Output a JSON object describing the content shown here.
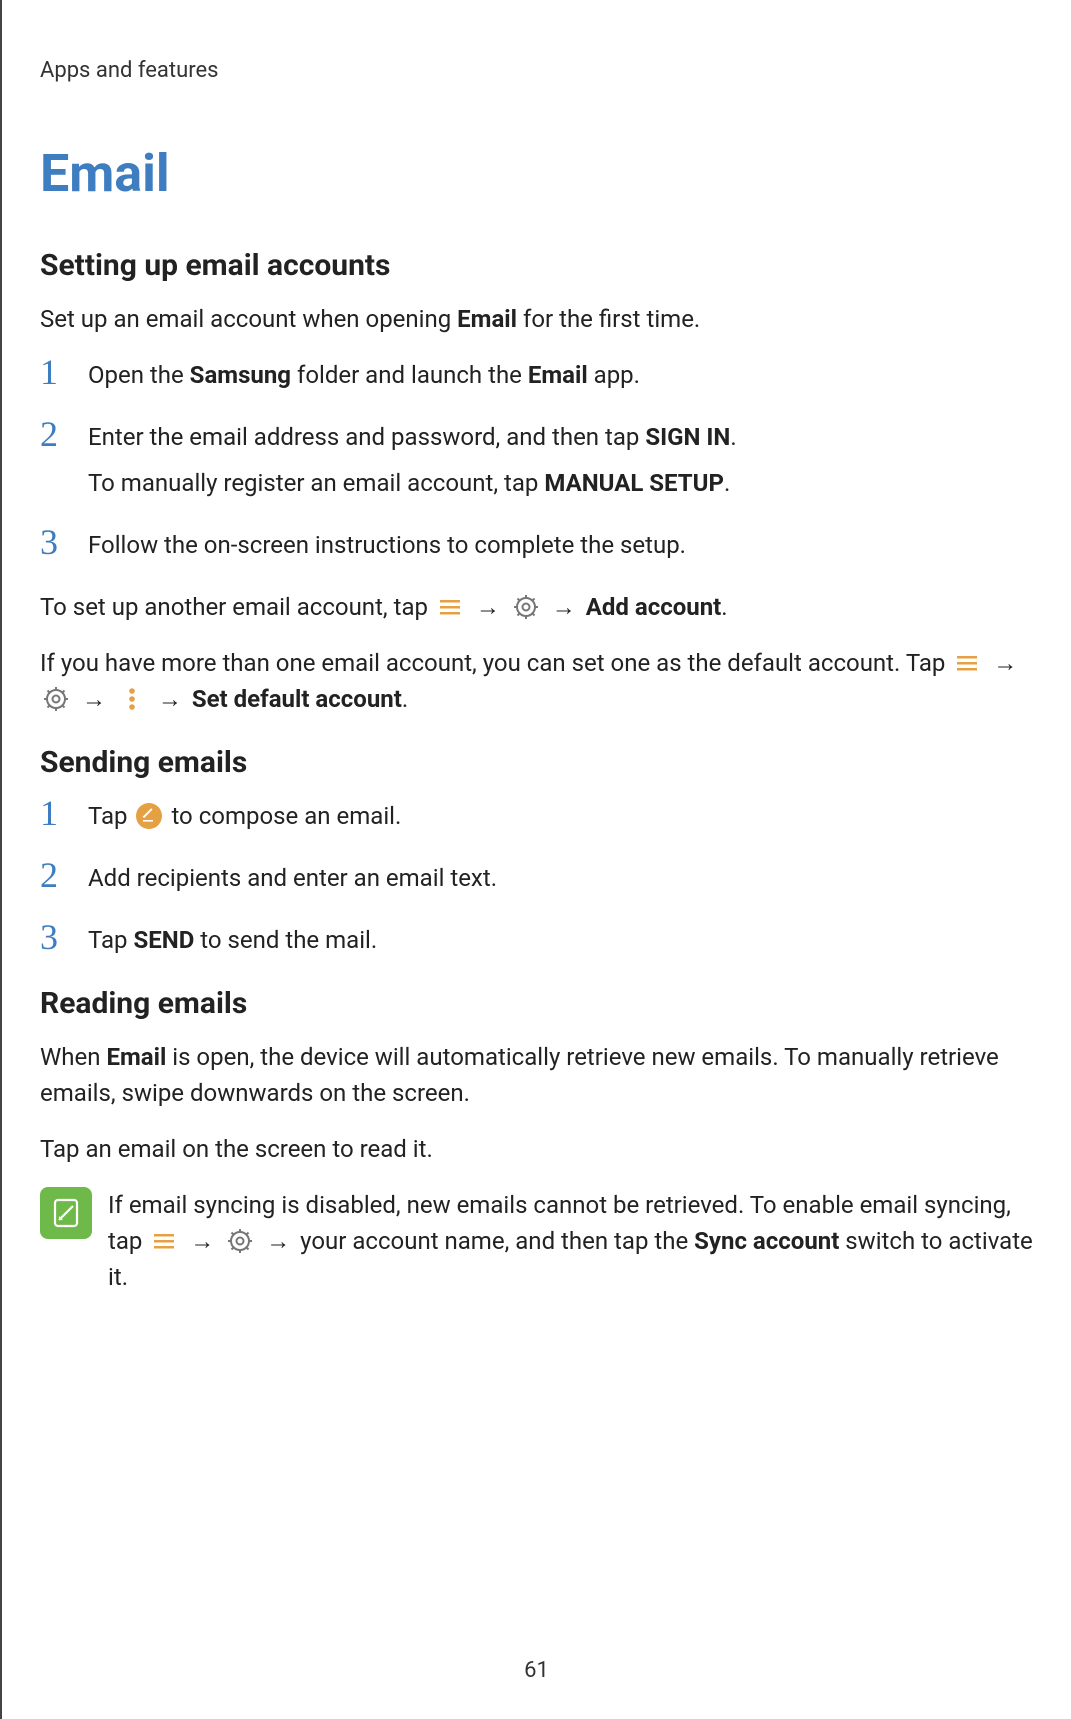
{
  "header": "Apps and features",
  "title": "Email",
  "page_number": "61",
  "section_setup": {
    "heading": "Setting up email accounts",
    "intro_pre": "Set up an email account when opening ",
    "intro_bold": "Email",
    "intro_post": " for the first time.",
    "steps": {
      "s1_pre": "Open the ",
      "s1_b1": "Samsung",
      "s1_mid": " folder and launch the ",
      "s1_b2": "Email",
      "s1_post": " app.",
      "s2_pre": "Enter the email address and password, and then tap ",
      "s2_b": "SIGN IN",
      "s2_post": ".",
      "s2_sub_pre": "To manually register an email account, tap ",
      "s2_sub_b": "MANUAL SETUP",
      "s2_sub_post": ".",
      "s3": "Follow the on-screen instructions to complete the setup."
    },
    "another_pre": "To set up another email account, tap ",
    "another_b": "Add account",
    "another_post": ".",
    "default_pre": "If you have more than one email account, you can set one as the default account. Tap ",
    "default_b": "Set default account",
    "default_post": "."
  },
  "section_send": {
    "heading": "Sending emails",
    "s1_pre": "Tap ",
    "s1_post": " to compose an email.",
    "s2": "Add recipients and enter an email text.",
    "s3_pre": "Tap ",
    "s3_b": "SEND",
    "s3_post": " to send the mail."
  },
  "section_read": {
    "heading": "Reading emails",
    "p1_pre": "When ",
    "p1_b": "Email",
    "p1_post": " is open, the device will automatically retrieve new emails. To manually retrieve emails, swipe downwards on the screen.",
    "p2": "Tap an email on the screen to read it.",
    "note_pre": "If email syncing is disabled, new emails cannot be retrieved. To enable email syncing, tap ",
    "note_mid": " your account name, and then tap the ",
    "note_b": "Sync account",
    "note_post": " switch to activate it."
  },
  "arrow": "→",
  "chart_data": null
}
